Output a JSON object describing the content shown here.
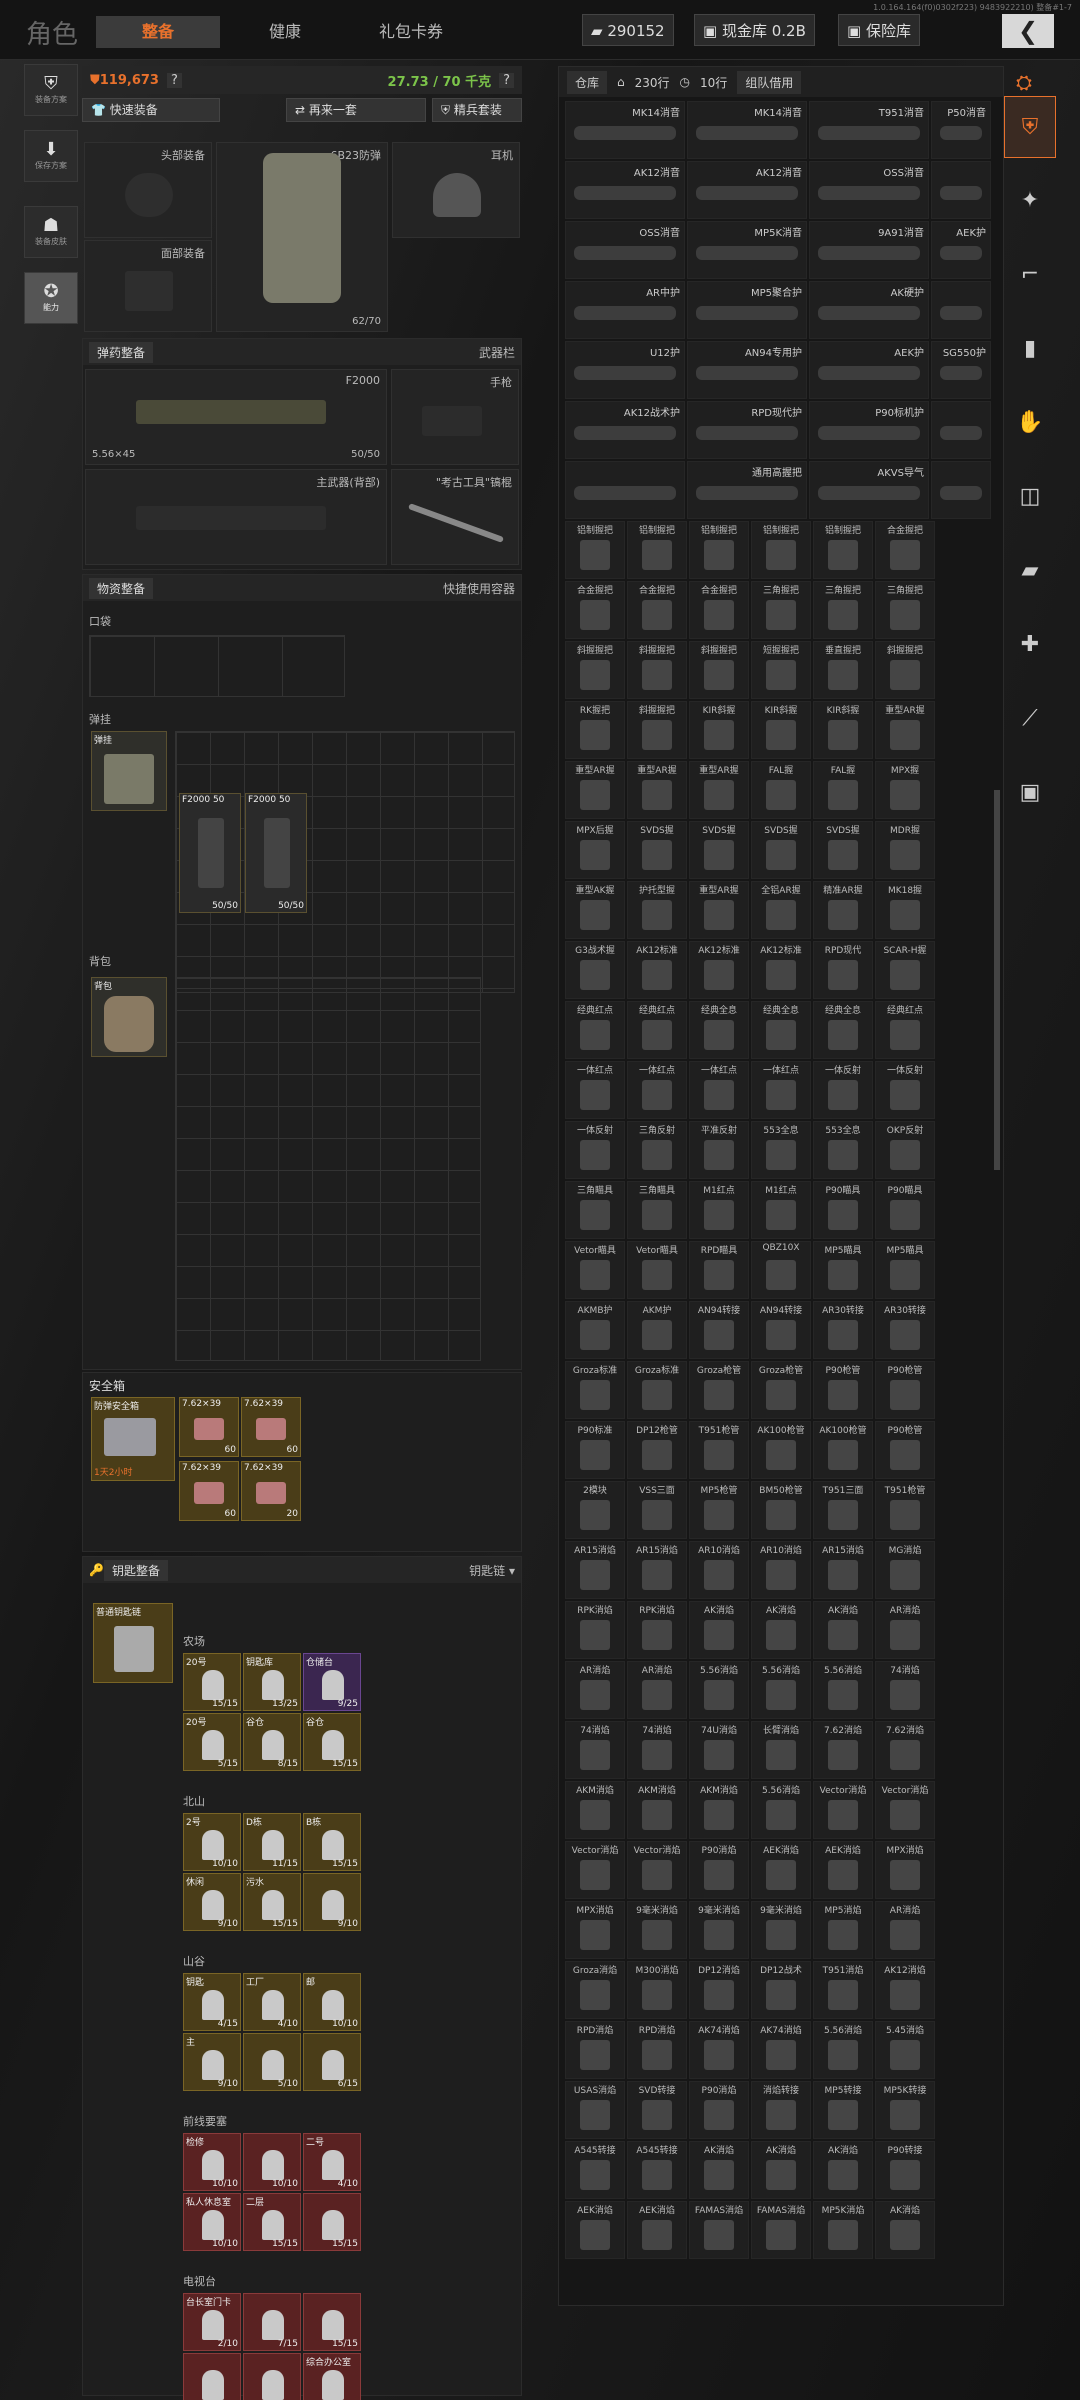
{
  "header": {
    "title": "角色",
    "tabs": [
      {
        "label": "整备",
        "active": true
      },
      {
        "label": "健康",
        "active": false
      },
      {
        "label": "礼包卡券",
        "active": false
      }
    ],
    "currency": "290152",
    "cash_vault": "现金库 0.2B",
    "safe_vault": "保险库",
    "version": "1.0.164.164(f0)0302f223) 9483922210) 整备#1-7"
  },
  "sidebar": {
    "items": [
      {
        "label": "装备方案",
        "icon": "armor-icon"
      },
      {
        "label": "保存方案",
        "icon": "download-icon"
      },
      {
        "label": "装备皮肤",
        "icon": "helmet-icon"
      },
      {
        "label": "能力",
        "icon": "ability-icon"
      }
    ]
  },
  "loadout": {
    "value": "119,673",
    "help": "?",
    "weight": "27.73 / 70 千克",
    "buttons": {
      "quick_equip": "快速装备",
      "again": "再来一套",
      "elite": "精兵套装"
    },
    "slots": {
      "head": "头部装备",
      "face": "面部装备",
      "armor_name": "6B23防弹",
      "armor_dur": "62/70",
      "ear": "耳机"
    },
    "ammo_section": {
      "title": "弹药整备",
      "right": "武器栏",
      "main_weapon": "F2000",
      "ammo": "5.56×45",
      "mag": "50/50",
      "pistol": "手枪",
      "backup": "主武器(背部)",
      "melee": "\"考古工具\"镐棍"
    },
    "supply": {
      "title": "物资整备",
      "right": "快捷使用容器",
      "pocket": "口袋",
      "rig": "弹挂",
      "rig_item": "弹挂",
      "mags": [
        {
          "name": "F2000 50",
          "count": "50/50"
        },
        {
          "name": "F2000 50",
          "count": "50/50"
        }
      ],
      "backpack": "背包",
      "backpack_item": "背包"
    },
    "safebox": {
      "label": "安全箱",
      "box_name": "防弹安全箱",
      "timer": "1天2小时",
      "ammo": [
        {
          "name": "7.62×39",
          "count": "60"
        },
        {
          "name": "7.62×39",
          "count": "60"
        },
        {
          "name": "7.62×39",
          "count": "60"
        },
        {
          "name": "7.62×39",
          "count": "20"
        }
      ]
    },
    "keys": {
      "title": "钥匙整备",
      "chain": "钥匙链",
      "holder": "普通钥匙链",
      "groups": [
        {
          "name": "农场",
          "items": [
            {
              "name": "20号",
              "count": "15/15",
              "cls": "k"
            },
            {
              "name": "钥匙库",
              "count": "13/25",
              "cls": "k"
            },
            {
              "name": "仓储台",
              "count": "9/25",
              "cls": "p"
            },
            {
              "name": "20号",
              "count": "5/15",
              "cls": "k"
            },
            {
              "name": "谷仓",
              "count": "8/15",
              "cls": "k"
            },
            {
              "name": "谷仓",
              "count": "15/15",
              "cls": "k"
            }
          ]
        },
        {
          "name": "北山",
          "items": [
            {
              "name": "2号",
              "count": "10/10",
              "cls": "k"
            },
            {
              "name": "D栋",
              "count": "11/15",
              "cls": "k"
            },
            {
              "name": "B栋",
              "count": "15/15",
              "cls": "k"
            },
            {
              "name": "休闲",
              "count": "9/10",
              "cls": "k"
            },
            {
              "name": "污水",
              "count": "15/15",
              "cls": "k"
            },
            {
              "name": "",
              "count": "9/10",
              "cls": "k"
            }
          ]
        },
        {
          "name": "山谷",
          "items": [
            {
              "name": "钥匙",
              "count": "4/15",
              "cls": "k"
            },
            {
              "name": "工厂",
              "count": "4/10",
              "cls": "k"
            },
            {
              "name": "邮",
              "count": "10/10",
              "cls": "k"
            },
            {
              "name": "主",
              "count": "9/10",
              "cls": "k"
            },
            {
              "name": "",
              "count": "5/10",
              "cls": "k"
            },
            {
              "name": "",
              "count": "6/15",
              "cls": "k"
            }
          ]
        },
        {
          "name": "前线要塞",
          "items": [
            {
              "name": "检修",
              "count": "10/10",
              "cls": "r"
            },
            {
              "name": "",
              "count": "10/10",
              "cls": "r"
            },
            {
              "name": "二号",
              "count": "4/10",
              "cls": "r"
            },
            {
              "name": "私人休息室",
              "count": "10/10",
              "cls": "r"
            },
            {
              "name": "二层",
              "count": "15/15",
              "cls": "r"
            },
            {
              "name": "",
              "count": "15/15",
              "cls": "r"
            }
          ]
        },
        {
          "name": "电视台",
          "items": [
            {
              "name": "台长室门卡",
              "count": "2/10",
              "cls": "r"
            },
            {
              "name": "",
              "count": "7/15",
              "cls": "r"
            },
            {
              "name": "",
              "count": "15/15",
              "cls": "r"
            },
            {
              "name": "",
              "count": "",
              "cls": "r"
            },
            {
              "name": "",
              "count": "",
              "cls": "r"
            },
            {
              "name": "综合办公室",
              "count": "",
              "cls": "r"
            }
          ]
        }
      ]
    }
  },
  "warehouse": {
    "title": "仓库",
    "rows": "230行",
    "rows2": "10行",
    "team": "组队借用",
    "wide_rows": [
      [
        "MK14消音",
        "MK14消音",
        "T951消音",
        "P50消音"
      ],
      [
        "AK12消音",
        "AK12消音",
        "OSS消音",
        ""
      ],
      [
        "OSS消音",
        "MP5K消音",
        "9A91消音",
        "AEK护"
      ],
      [
        "AR中护",
        "MP5聚合护",
        "AK硬护",
        ""
      ],
      [
        "U12护",
        "AN94专用护",
        "AEK护",
        "SG550护"
      ],
      [
        "AK12战术护",
        "RPD现代护",
        "P90标机护",
        ""
      ],
      [
        "",
        "通用高握把",
        "AKVS导气",
        ""
      ]
    ],
    "small_rows": [
      [
        "铝制握把",
        "铝制握把",
        "铝制握把",
        "铝制握把",
        "铝制握把",
        "合金握把"
      ],
      [
        "合金握把",
        "合金握把",
        "合金握把",
        "三角握把",
        "三角握把",
        "三角握把"
      ],
      [
        "斜握握把",
        "斜握握把",
        "斜握握把",
        "短握握把",
        "垂直握把",
        "斜握握把"
      ],
      [
        "RK握把",
        "斜握握把",
        "KIR斜握",
        "KIR斜握",
        "KIR斜握",
        "重型AR握"
      ],
      [
        "重型AR握",
        "重型AR握",
        "重型AR握",
        "FAL握",
        "FAL握",
        "MPX握"
      ],
      [
        "MPX后握",
        "SVDS握",
        "SVDS握",
        "SVDS握",
        "SVDS握",
        "MDR握"
      ],
      [
        "重型AK握",
        "护托型握",
        "重型AR握",
        "全铝AR握",
        "精准AR握",
        "MK18握"
      ],
      [
        "G3战术握",
        "AK12标准",
        "AK12标准",
        "AK12标准",
        "RPD现代",
        "SCAR-H握"
      ],
      [
        "经典红点",
        "经典红点",
        "经典全息",
        "经典全息",
        "经典全息",
        "经典红点"
      ],
      [
        "一体红点",
        "一体红点",
        "一体红点",
        "一体红点",
        "一体反射",
        "一体反射"
      ],
      [
        "一体反射",
        "三角反射",
        "平准反射",
        "553全息",
        "553全息",
        "OKP反射"
      ],
      [
        "三角瞄具",
        "三角瞄具",
        "M1红点",
        "M1红点",
        "P90瞄具",
        "P90瞄具"
      ],
      [
        "Vetor瞄具",
        "Vetor瞄具",
        "RPD瞄具",
        "QBZ10X",
        "MP5瞄具",
        "MP5瞄具"
      ],
      [
        "AKMB护",
        "AKM护",
        "AN94转接",
        "AN94转接",
        "AR30转接",
        "AR30转接"
      ],
      [
        "Groza标准",
        "Groza标准",
        "Groza枪管",
        "Groza枪管",
        "P90枪管",
        "P90枪管"
      ],
      [
        "P90标准",
        "DP12枪管",
        "T951枪管",
        "AK100枪管",
        "AK100枪管",
        "P90枪管"
      ],
      [
        "2模块",
        "VSS三面",
        "MP5枪管",
        "BM50枪管",
        "T951三面",
        "T951枪管"
      ],
      [
        "AR15消焰",
        "AR15消焰",
        "AR10消焰",
        "AR10消焰",
        "AR15消焰",
        "MG消焰"
      ],
      [
        "RPK消焰",
        "RPK消焰",
        "AK消焰",
        "AK消焰",
        "AK消焰",
        "AR消焰"
      ],
      [
        "AR消焰",
        "AR消焰",
        "5.56消焰",
        "5.56消焰",
        "5.56消焰",
        "74消焰"
      ],
      [
        "74消焰",
        "74消焰",
        "74U消焰",
        "长臂消焰",
        "7.62消焰",
        "7.62消焰"
      ],
      [
        "AKM消焰",
        "AKM消焰",
        "AKM消焰",
        "5.56消焰",
        "Vector消焰",
        "Vector消焰"
      ],
      [
        "Vector消焰",
        "Vector消焰",
        "P90消焰",
        "AEK消焰",
        "AEK消焰",
        "MPX消焰"
      ],
      [
        "MPX消焰",
        "9毫米消焰",
        "9毫米消焰",
        "9毫米消焰",
        "MP5消焰",
        "AR消焰"
      ],
      [
        "Groza消焰",
        "M300消焰",
        "DP12消焰",
        "DP12战术",
        "T951消焰",
        "AK12消焰"
      ],
      [
        "RPD消焰",
        "RPD消焰",
        "AK74消焰",
        "AK74消焰",
        "5.56消焰",
        "5.45消焰"
      ],
      [
        "USAS消焰",
        "SVD转接",
        "P90消焰",
        "消焰转接",
        "MP5转接",
        "MP5K转接"
      ],
      [
        "A545转接",
        "A545转接",
        "AK消焰",
        "AK消焰",
        "AK消焰",
        "P90转接"
      ],
      [
        "AEK消焰",
        "AEK消焰",
        "FAMAS消焰",
        "FAMAS消焰",
        "MP5K消焰",
        "AK消焰"
      ]
    ]
  },
  "right_sidebar": {
    "icons": [
      "armor-category-icon",
      "weapon-icon",
      "rifle-icon",
      "magazine-icon",
      "grip-icon",
      "scope-icon",
      "stock-icon",
      "tactical-icon",
      "muzzle-icon",
      "ammo-box-icon"
    ]
  }
}
